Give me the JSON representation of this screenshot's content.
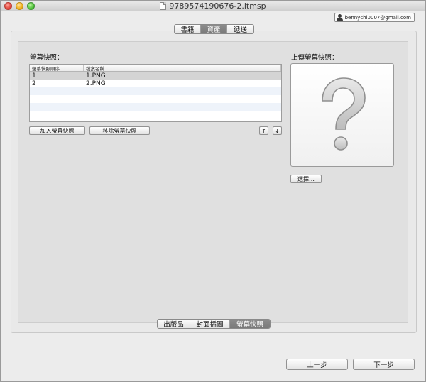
{
  "window": {
    "title": "9789574190676-2.itmsp"
  },
  "account": {
    "email": "bennychi0007@gmail.com"
  },
  "top_tabs": [
    {
      "label": "書籍",
      "active": false
    },
    {
      "label": "資產",
      "active": true
    },
    {
      "label": "遞送",
      "active": false
    }
  ],
  "screenshots": {
    "section_label": "螢幕快照：",
    "columns": [
      "螢幕快照順序",
      "檔案名稱"
    ],
    "rows": [
      {
        "order": "1",
        "file": "1.PNG",
        "selected": true
      },
      {
        "order": "2",
        "file": "2.PNG",
        "selected": false
      }
    ],
    "add_button": "加入螢幕快照",
    "remove_button": "移除螢幕快照",
    "move_up": "↑",
    "move_down": "↓"
  },
  "upload": {
    "label": "上傳螢幕快照：",
    "placeholder_icon": "question-mark-icon",
    "choose_button": "選擇…"
  },
  "bottom_tabs": [
    {
      "label": "出版品",
      "active": false
    },
    {
      "label": "封面插圖",
      "active": false
    },
    {
      "label": "螢幕快照",
      "active": true
    }
  ],
  "nav": {
    "back": "上一步",
    "next": "下一步"
  }
}
